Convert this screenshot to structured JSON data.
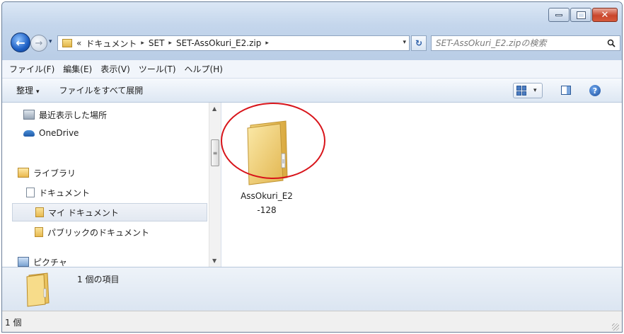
{
  "window": {
    "caption": {
      "minimize": "–",
      "maximize": "□",
      "close": "✕"
    }
  },
  "nav": {
    "back": "←",
    "forward": "→",
    "history": "▾",
    "address": {
      "overflow": "«",
      "crumbs": [
        "ドキュメント",
        "SET",
        "SET-AssOkuri_E2.zip"
      ],
      "separator": "▸",
      "dropdown": "▾"
    },
    "refresh": "↻",
    "search_placeholder": "SET-AssOkuri_E2.zipの検索"
  },
  "menubar": {
    "items": [
      "ファイル(F)",
      "編集(E)",
      "表示(V)",
      "ツール(T)",
      "ヘルプ(H)"
    ]
  },
  "commandbar": {
    "organize": "整理",
    "organize_dd": "▾",
    "extract_all": "ファイルをすべて展開",
    "view_dd": "▾",
    "help": "?"
  },
  "navpane": {
    "items": [
      {
        "label": "最近表示した場所",
        "icon": "recent-places-icon"
      },
      {
        "label": "OneDrive",
        "icon": "onedrive-icon"
      },
      {
        "label": "ライブラリ",
        "icon": "library-icon"
      },
      {
        "label": "ドキュメント",
        "icon": "document-icon"
      },
      {
        "label": "マイ ドキュメント",
        "icon": "folder-icon",
        "selected": true
      },
      {
        "label": "パブリックのドキュメント",
        "icon": "folder-icon"
      },
      {
        "label": "ピクチャ",
        "icon": "pictures-icon"
      }
    ],
    "scroll_up": "▲",
    "scroll_down": "▼",
    "thumb_grip": "≡"
  },
  "content": {
    "files": [
      {
        "name_line1": "AssOkuri_E2",
        "name_line2": "-128",
        "icon": "folder-icon"
      }
    ]
  },
  "details": {
    "count_text": "1 個の項目"
  },
  "statusbar": {
    "text": "1 個"
  },
  "colors": {
    "highlight_ring": "#d8141a",
    "accent": "#1d5fc4"
  }
}
